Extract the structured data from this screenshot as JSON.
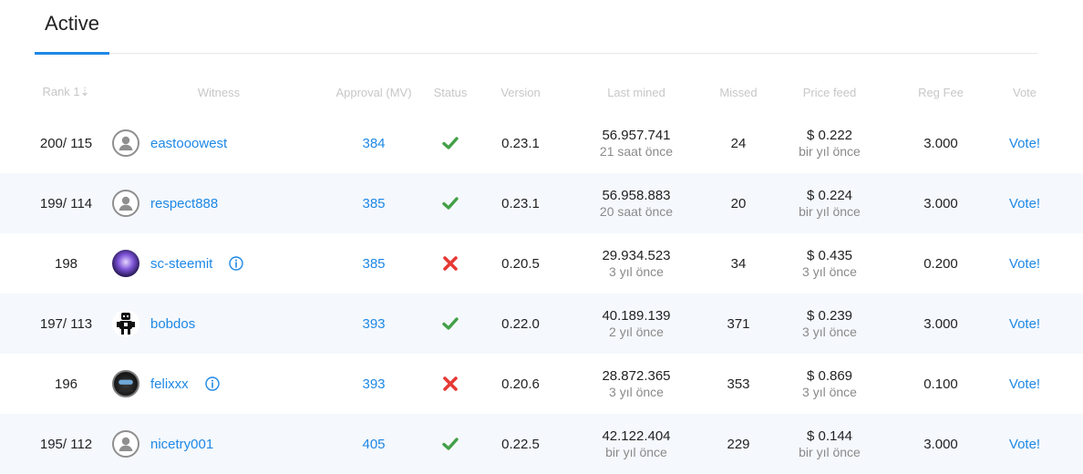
{
  "tabs": {
    "active_label": "Active"
  },
  "table": {
    "headers": {
      "rank": "Rank 1⇣",
      "witness": "Witness",
      "approval": "Approval (MV)",
      "status": "Status",
      "version": "Version",
      "last_mined": "Last mined",
      "missed": "Missed",
      "price_feed": "Price feed",
      "reg_fee": "Reg Fee",
      "vote": "Vote"
    },
    "rows": [
      {
        "rank": "200/ 115",
        "witness": "eastooowest",
        "approval": "384",
        "status": "active",
        "version": "0.23.1",
        "last_mined": "56.957.741",
        "last_mined_ago": "21 saat önce",
        "missed": "24",
        "price": "$ 0.222",
        "price_ago": "bir yıl önce",
        "reg_fee": "3.000",
        "vote": "Vote!"
      },
      {
        "rank": "199/ 114",
        "witness": "respect888",
        "approval": "385",
        "status": "active",
        "version": "0.23.1",
        "last_mined": "56.958.883",
        "last_mined_ago": "20 saat önce",
        "missed": "20",
        "price": "$ 0.224",
        "price_ago": "bir yıl önce",
        "reg_fee": "3.000",
        "vote": "Vote!"
      },
      {
        "rank": "198",
        "witness": "sc-steemit",
        "approval": "385",
        "status": "disabled",
        "version": "0.20.5",
        "last_mined": "29.934.523",
        "last_mined_ago": "3 yıl önce",
        "missed": "34",
        "price": "$ 0.435",
        "price_ago": "3 yıl önce",
        "reg_fee": "0.200",
        "vote": "Vote!"
      },
      {
        "rank": "197/ 113",
        "witness": "bobdos",
        "approval": "393",
        "status": "active",
        "version": "0.22.0",
        "last_mined": "40.189.139",
        "last_mined_ago": "2 yıl önce",
        "missed": "371",
        "price": "$ 0.239",
        "price_ago": "3 yıl önce",
        "reg_fee": "3.000",
        "vote": "Vote!"
      },
      {
        "rank": "196",
        "witness": "felixxx",
        "approval": "393",
        "status": "disabled",
        "version": "0.20.6",
        "last_mined": "28.872.365",
        "last_mined_ago": "3 yıl önce",
        "missed": "353",
        "price": "$ 0.869",
        "price_ago": "3 yıl önce",
        "reg_fee": "0.100",
        "vote": "Vote!"
      },
      {
        "rank": "195/ 112",
        "witness": "nicetry001",
        "approval": "405",
        "status": "active",
        "version": "0.22.5",
        "last_mined": "42.122.404",
        "last_mined_ago": "bir yıl önce",
        "missed": "229",
        "price": "$ 0.144",
        "price_ago": "bir yıl önce",
        "reg_fee": "3.000",
        "vote": "Vote!"
      }
    ]
  },
  "colors": {
    "accent": "#1e88e5",
    "ok": "#43a047",
    "bad": "#e53935"
  },
  "icons": {
    "active": "checkmark-icon",
    "disabled": "cross-icon",
    "info": "info-icon",
    "avatar": "user-avatar-icon"
  }
}
